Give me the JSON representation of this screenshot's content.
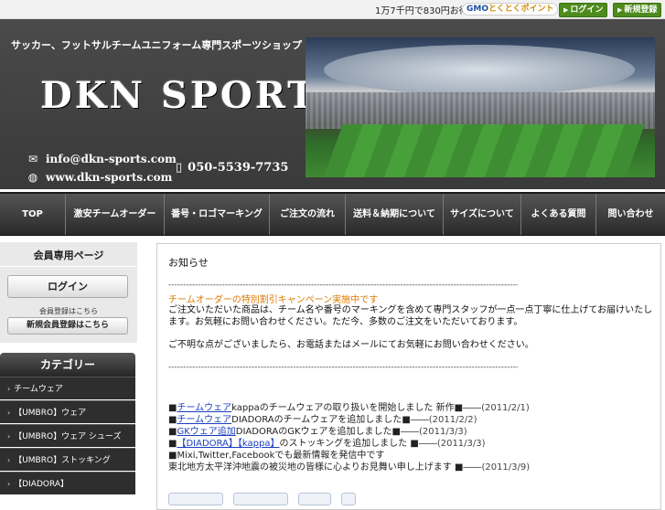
{
  "topbar": {
    "message": "1万7千円で830円お得に支払う",
    "gmo_logo": "GMOとくとくポイント",
    "login": "ログイン",
    "register": "新規登録"
  },
  "header": {
    "tagline": "サッカー、フットサルチームユニフォーム専門スポーツショップ",
    "logo": "DKN  SPORTS",
    "email": "info@dkn-sports.com",
    "website": "www.dkn-sports.com",
    "phone": "050-5539-7735",
    "email_icon": "envelope-icon",
    "web_icon": "globe-icon",
    "phone_icon": "mobile-phone-icon"
  },
  "nav": {
    "items": [
      "TOP",
      "激安チームオーダー",
      "番号・ロゴマーキング",
      "ご注文の流れ",
      "送料＆納期について",
      "サイズについて",
      "よくある質問",
      "問い合わせ"
    ]
  },
  "sidebar": {
    "member_title": "会員専用ページ",
    "login": "ログイン",
    "note": "会員登録はこちら",
    "register": "新規会員登録はこちら",
    "category_title": "カテゴリー",
    "categories": [
      "チームウェア",
      "【UMBRO】ウェア",
      "【UMBRO】ウェア シューズ",
      "【UMBRO】ストッキング",
      "【DIADORA】"
    ]
  },
  "main": {
    "heading": "お知らせ",
    "divider": "-----------------------------------------------------------------------------------------------------------------------------",
    "highlight": "チームオーダーの特別割引キャンペーン実施中です",
    "para1": "ご注文いただいた商品は、チーム名や番号のマーキングを含めて専門スタッフが一点一点丁寧に仕上げてお届けいたします。お気軽にお問い合わせください。ただ今、多数のご注文をいただいております。",
    "para2": "ご不明な点がございましたら、お電話またはメールにてお気軽にお問い合わせください。",
    "news": [
      {
        "link": "チームウェア",
        "text": "kappaのチームウェアの取り扱いを開始しました 新作",
        "date": "(2011/2/1)"
      },
      {
        "link": "チームウェア",
        "text": "DIADORAのチームウェアを追加しました",
        "date": "(2011/2/2)"
      },
      {
        "link": "GKウェア追加",
        "text": "DIADORAのGKウェアを追加しました",
        "date": "(2011/3/3)"
      },
      {
        "link": "【DIADORA】【kappa】",
        "text": "のストッキングを追加しました ",
        "date": "(2011/3/3)"
      },
      {
        "link": "",
        "text": "Mixi,Twitter,Facebookでも最新情報を発信中です",
        "date": ""
      },
      {
        "link": "",
        "text": "東北地方太平洋沖地震の被災地の皆様に心よりお見舞い申し上げます ",
        "date": "(2011/3/9)"
      }
    ]
  }
}
